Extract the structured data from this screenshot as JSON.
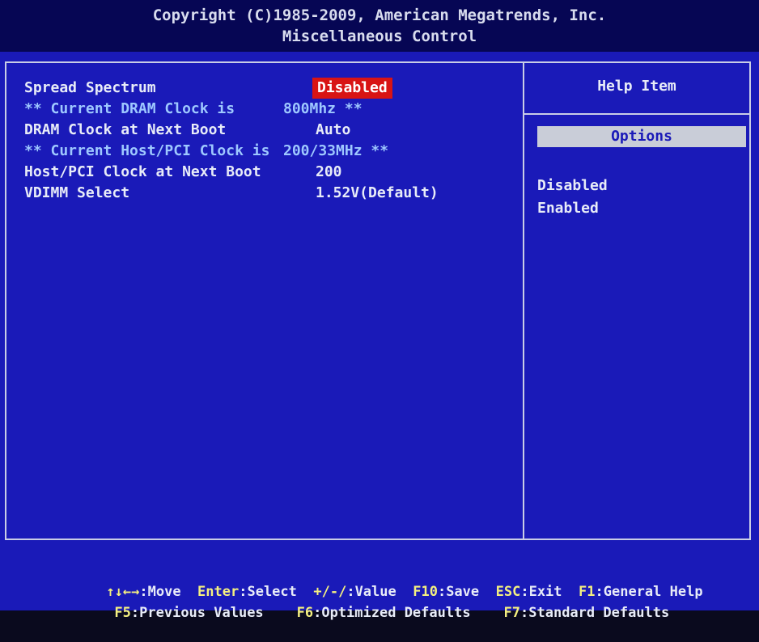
{
  "header": {
    "copyright": "Copyright (C)1985-2009, American Megatrends, Inc.",
    "title": "Miscellaneous Control"
  },
  "settings": [
    {
      "label": "Spread Spectrum",
      "value": "Disabled",
      "type": "setting",
      "selected": true
    },
    {
      "label": "** Current DRAM Clock is",
      "value": "800Mhz **",
      "type": "info"
    },
    {
      "label": "DRAM Clock at Next Boot",
      "value": "Auto",
      "type": "setting"
    },
    {
      "label": "** Current Host/PCI Clock is",
      "value": "200/33MHz **",
      "type": "info"
    },
    {
      "label": "Host/PCI Clock at Next Boot",
      "value": "200",
      "type": "setting"
    },
    {
      "label": "VDIMM Select",
      "value": "1.52V(Default)",
      "type": "setting"
    }
  ],
  "help": {
    "title": "Help Item",
    "options_label": "Options",
    "options": [
      "Disabled",
      "Enabled"
    ]
  },
  "footer": {
    "line1": [
      {
        "key": "↑↓←→",
        "desc": ":Move"
      },
      {
        "key": "Enter",
        "desc": ":Select"
      },
      {
        "key": "+/-/",
        "desc": ":Value"
      },
      {
        "key": "F10",
        "desc": ":Save"
      },
      {
        "key": "ESC",
        "desc": ":Exit"
      },
      {
        "key": "F1",
        "desc": ":General Help"
      }
    ],
    "line2": [
      {
        "key": "F5",
        "desc": ":Previous Values"
      },
      {
        "key": "F6",
        "desc": ":Optimized Defaults"
      },
      {
        "key": "F7",
        "desc": ":Standard Defaults"
      }
    ]
  },
  "colors": {
    "background": "#1a1ab8",
    "header": "#060654",
    "highlight": "#d81414",
    "info_text": "#9ec8ff",
    "text": "#e8ecf8"
  }
}
